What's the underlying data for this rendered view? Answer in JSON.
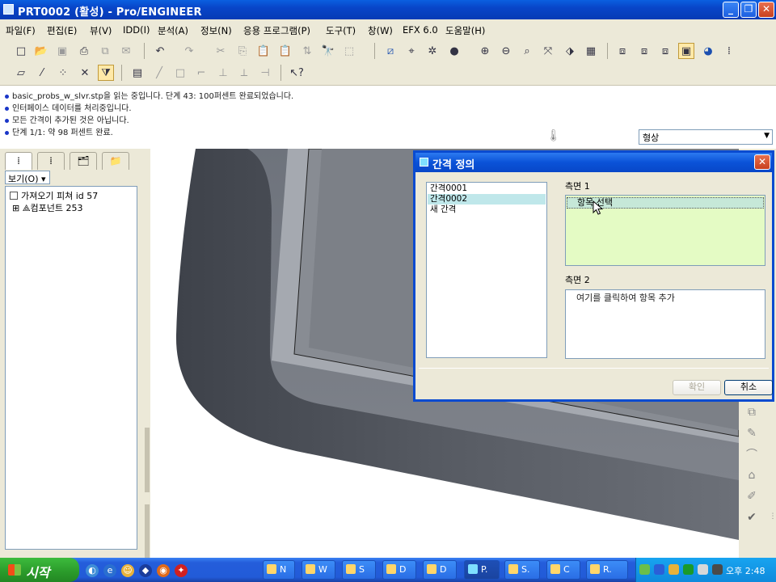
{
  "window": {
    "title": "PRT0002 (활성) - Pro/ENGINEER",
    "buttons": {
      "minimize": "_",
      "maximize": "❐",
      "close": "✕"
    }
  },
  "menu": [
    "파일(F)",
    "편집(E)",
    "뷰(V)",
    "IDD(I)",
    "분석(A)",
    "정보(N)",
    "응용 프로그램(P)",
    "도구(T)",
    "창(W)",
    "EFX 6.0",
    "도움말(H)"
  ],
  "toolbar": {
    "row1": [
      "new-icon",
      "open-icon",
      "save-icon",
      "print-icon",
      "copy-doc-icon",
      "email-icon",
      "undo-icon",
      "redo-icon",
      "cut-icon",
      "copy-icon",
      "paste-icon",
      "paste-special-icon",
      "regenerate-icon",
      "find-icon",
      "select-box-icon",
      "orient-icon",
      "datum-icon",
      "spin-center-icon",
      "shading-icon",
      "zoom-in-icon",
      "zoom-out-icon",
      "refit-icon",
      "reorient-icon",
      "saved-views-icon",
      "wireframe-icon",
      "hidden-line-icon",
      "no-hidden-icon",
      "shaded-icon",
      "layer-icon",
      "model-tree-icon"
    ],
    "row2": [
      "plane-icon",
      "axis-icon",
      "point-icon",
      "csys-icon",
      "filter-icon",
      "sketch-icon",
      "line-icon",
      "rect-icon",
      "dim-icon",
      "constraint-icon",
      "mirror-icon",
      "trim-icon",
      "whats-this-icon"
    ]
  },
  "messages": [
    "basic_probs_w_slvr.stp을 읽는 중입니다. 단계 43: 100퍼센트 완료되었습니다.",
    "인터페이스 데이터를 처리중입니다.",
    "모든 간격이 추가된 것은 아닙니다.",
    "단계 1/1: 약 98 퍼센트 완료."
  ],
  "filter": {
    "selected": "형상"
  },
  "left_panel": {
    "view_dropdown": "보기(O)",
    "tree": [
      {
        "label": "가져오기 피쳐 id 57"
      },
      {
        "label": "컴포넌트 253"
      }
    ]
  },
  "dialog": {
    "title": "간격 정의",
    "list": [
      "간격0001",
      "간격0002",
      "새 간격"
    ],
    "selected_index": 1,
    "side1_label": "측면 1",
    "side1_item": "항목 선택",
    "side2_label": "측면 2",
    "side2_hint": "여기를 클릭하여 항목 추가",
    "ok_label": "확인",
    "cancel_label": "취소"
  },
  "taskbar": {
    "start_label": "시작",
    "tasks": [
      "N",
      "W",
      "S",
      "D",
      "D",
      "P.",
      "S.",
      "C",
      "R."
    ],
    "active_task_index": 5,
    "clock": "오후 2:48"
  },
  "colors": {
    "xp_blue": "#0a52d8",
    "model_gray": "#7a7e87",
    "side1_bg": "#e4fbc4",
    "selected_row": "#bfe7ea"
  }
}
